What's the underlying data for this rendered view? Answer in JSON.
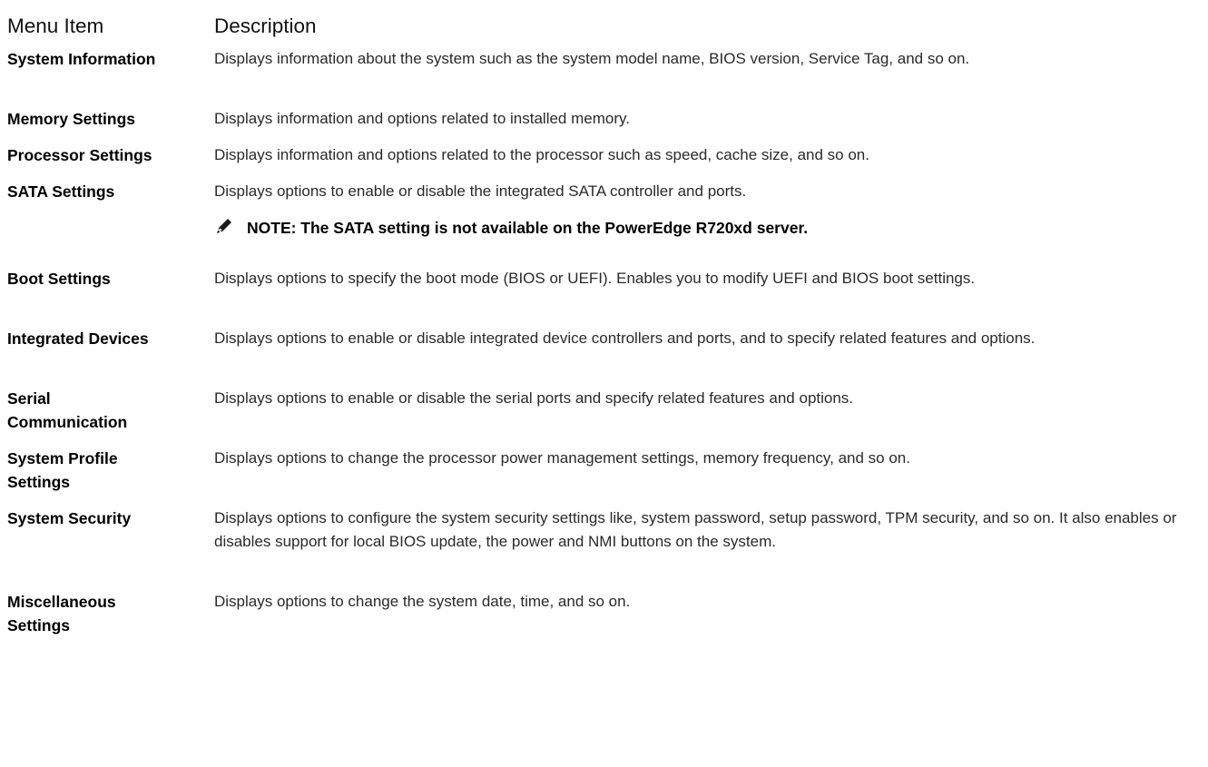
{
  "header": {
    "menu_item": "Menu Item",
    "description": "Description"
  },
  "rows": [
    {
      "label": "System Information",
      "description": "Displays information about the system such as the system model name, BIOS version, Service Tag, and so on."
    },
    {
      "label": "Memory Settings",
      "description": "Displays information and options related to installed memory."
    },
    {
      "label": "Processor Settings",
      "description": "Displays information and options related to the processor such as speed, cache size, and so on."
    },
    {
      "label": "SATA Settings",
      "description": "Displays options to enable or disable the integrated SATA controller and ports."
    },
    {
      "label": "Boot Settings",
      "description": "Displays options to specify the boot mode (BIOS or UEFI). Enables you to modify UEFI and BIOS boot settings."
    },
    {
      "label": "Integrated Devices",
      "description": "Displays options to enable or disable integrated device controllers and ports, and to specify related features and options."
    },
    {
      "label": "Serial Communication",
      "description": "Displays options to enable or disable the serial ports and specify related features and options."
    },
    {
      "label": "System Profile Settings",
      "description": "Displays options to change the processor power management settings, memory frequency, and so on."
    },
    {
      "label": "System Security",
      "description": "Displays options to configure the system security settings like, system password, setup password, TPM security, and so on. It also enables or disables support for local BIOS update, the power and NMI buttons on the system."
    },
    {
      "label": "Miscellaneous Settings",
      "description": "Displays options to change the system date, time, and so on."
    }
  ],
  "note": {
    "icon": "note-pencil-icon",
    "text": "NOTE: The SATA setting is not available on the PowerEdge R720xd server."
  }
}
